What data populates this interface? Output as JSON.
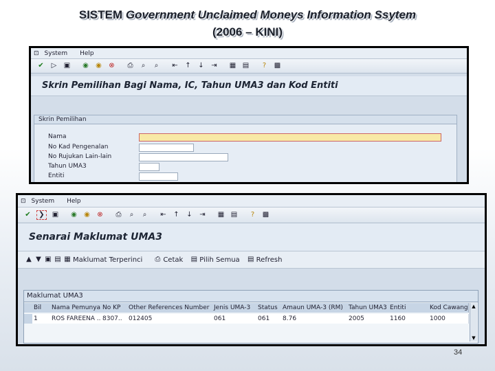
{
  "slide": {
    "title_line1_a": "SISTEM ",
    "title_line1_b": "Government Unclaimed Moneys Information Ssytem",
    "title_line2": "(2006 – KINI)",
    "page_number": "34"
  },
  "win1": {
    "menu": [
      "System",
      "Help"
    ],
    "header": "Skrin Pemilihan Bagi Nama, IC, Tahun UMA3 dan Kod Entiti",
    "group_title": "Skrin Pemilihan",
    "fields": [
      {
        "label": "Nama"
      },
      {
        "label": "No Kad Pengenalan"
      },
      {
        "label": "No Rujukan Lain-lain"
      },
      {
        "label": "Tahun UMA3"
      },
      {
        "label": "Entiti"
      }
    ]
  },
  "win2": {
    "menu": [
      "System",
      "Help"
    ],
    "header": "Senarai Maklumat UMA3",
    "actions": [
      "Maklumat Terperinci",
      "Cetak",
      "Pilih Semua",
      "Refresh"
    ],
    "table_title": "Maklumat UMA3",
    "columns": [
      "Bil",
      "Nama Pemunya",
      "No KP",
      "Other References Number",
      "Jenis UMA-3",
      "Status",
      "Amaun UMA-3 (RM)",
      "Tahun UMA3",
      "Entiti",
      "Kod Cawang"
    ],
    "rows": [
      [
        "1",
        "ROS FAREENA ..",
        "8307..",
        "012405",
        "061",
        "061",
        "8.76",
        "2005",
        "1160",
        "1000"
      ]
    ]
  }
}
